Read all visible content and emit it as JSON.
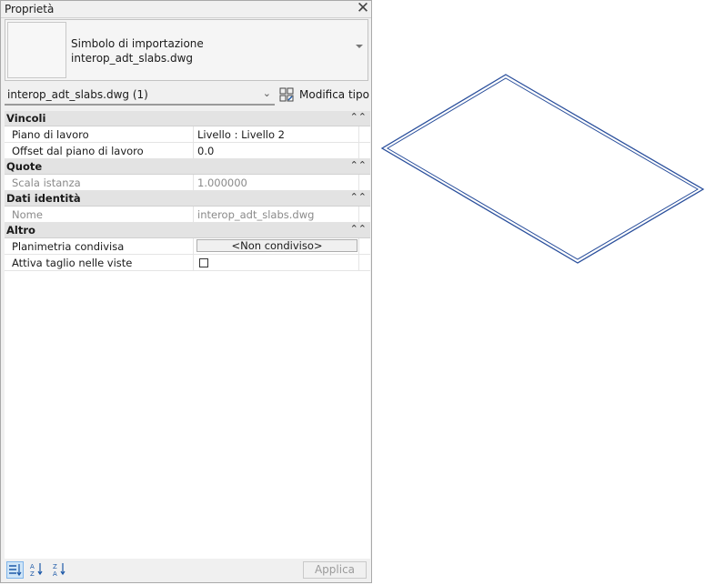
{
  "panel": {
    "title": "Proprietà",
    "close_glyph": "✕"
  },
  "type_selector": {
    "family": "Simbolo di importazione",
    "type": "interop_adt_slabs.dwg"
  },
  "instance_filter": {
    "label": "interop_adt_slabs.dwg (1)",
    "arrow": "⌄",
    "edit_type_label": "Modifica tipo"
  },
  "groups": {
    "vincoli": {
      "label": "Vincoli",
      "rows": [
        {
          "name": "Piano di lavoro",
          "value": "Livello : Livello 2"
        },
        {
          "name": "Offset dal piano di lavoro",
          "value": "0.0"
        }
      ]
    },
    "quote": {
      "label": "Quote",
      "rows": [
        {
          "name": "Scala istanza",
          "value": "1.000000"
        }
      ]
    },
    "dati_identita": {
      "label": "Dati identità",
      "rows": [
        {
          "name": "Nome",
          "value": "interop_adt_slabs.dwg"
        }
      ]
    },
    "altro": {
      "label": "Altro",
      "rows": [
        {
          "name": "Planimetria condivisa",
          "value": "<Non condiviso>"
        },
        {
          "name": "Attiva taglio nelle viste",
          "checked": false
        }
      ]
    }
  },
  "collapse_glyph": "⌃⌃",
  "bottom": {
    "apply_label": "Applica",
    "icons": [
      "categorize-icon",
      "sort-ascending-icon",
      "sort-descending-icon"
    ]
  },
  "colors": {
    "accent": "#1e5aa8",
    "slab_outline": "#2a4f9c",
    "active_tool_bg": "#cfe5f7"
  }
}
